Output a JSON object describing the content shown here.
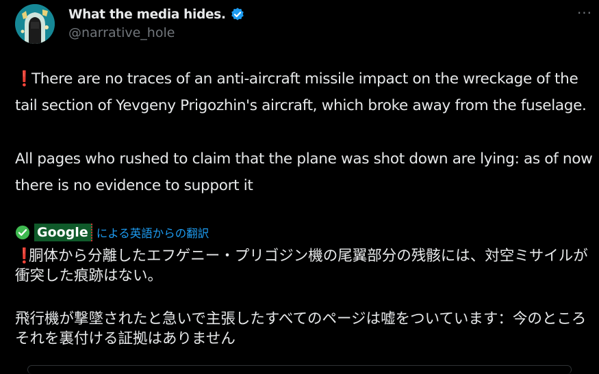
{
  "author": {
    "display_name": "What the media hides.",
    "handle": "@narrative_hole",
    "verified": true,
    "avatar_icon": "hooded-figure-avatar",
    "verified_icon": "verified-badge-icon",
    "accent_color": "#1d9bf0"
  },
  "menu": {
    "more_label": "···"
  },
  "tweet": {
    "marker": "❗",
    "paragraph1": "There are no traces of an anti-aircraft missile impact on the wreckage of the tail section of Yevgeny Prigozhin's aircraft, which broke away from the fuselage.",
    "paragraph2": "All pages who rushed to claim that the plane was shot down are lying: as of now there is no evidence to support it"
  },
  "translation": {
    "provider": "Google",
    "label": "による英語からの翻訳",
    "marker": "❗",
    "paragraph1": "胴体から分離したエフゲニー・プリゴジン機の尾翼部分の残骸には、対空ミサイルが衝突した痕跡はない。",
    "paragraph2": "飛行機が撃墜されたと急いで主張したすべてのページは嘘をついています：今のところそれを裏付ける証拠はありません"
  }
}
